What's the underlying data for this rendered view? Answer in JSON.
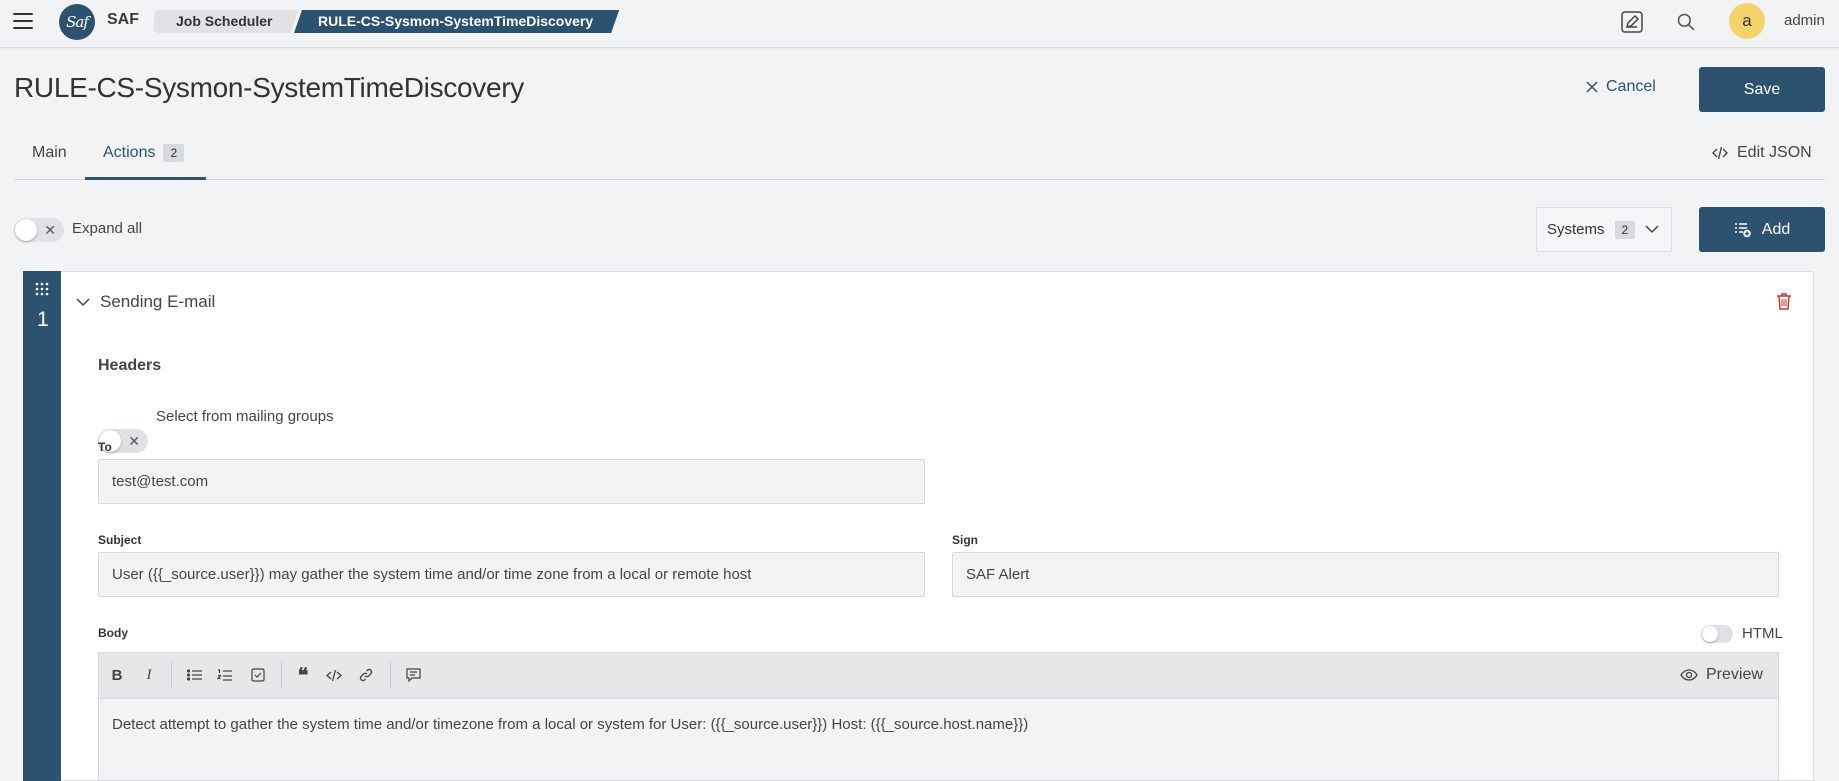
{
  "header": {
    "app_name": "SAF",
    "logo_text": "Saf",
    "breadcrumbs": [
      "Job Scheduler",
      "RULE-CS-Sysmon-SystemTimeDiscovery"
    ],
    "avatar_letter": "a",
    "username": "admin"
  },
  "page": {
    "title": "RULE-CS-Sysmon-SystemTimeDiscovery",
    "cancel_label": "Cancel",
    "save_label": "Save"
  },
  "tabs": [
    {
      "label": "Main"
    },
    {
      "label": "Actions",
      "badge": "2"
    }
  ],
  "edit_json_label": "Edit JSON",
  "toolbar": {
    "expand_all_label": "Expand all",
    "systems_label": "Systems",
    "systems_count": "2",
    "add_label": "Add"
  },
  "action": {
    "number": "1",
    "title": "Sending E-mail",
    "headers_title": "Headers",
    "mailing_groups_label": "Select from mailing groups",
    "to_label": "To",
    "to_value": "test@test.com",
    "subject_label": "Subject",
    "subject_value": "User ({{_source.user}}) may gather the system time and/or time zone from a local or remote host",
    "sign_label": "Sign",
    "sign_value": "SAF Alert",
    "body_label": "Body",
    "html_label": "HTML",
    "preview_label": "Preview",
    "body_value": "Detect attempt to gather the system time and/or timezone from a local or system for User: ({{_source.user}}) Host: ({{_source.host.name}})"
  },
  "colors": {
    "primary": "#2d5270",
    "background": "#f2f3f4",
    "avatar": "#f3d46b",
    "danger": "#c0392b"
  }
}
